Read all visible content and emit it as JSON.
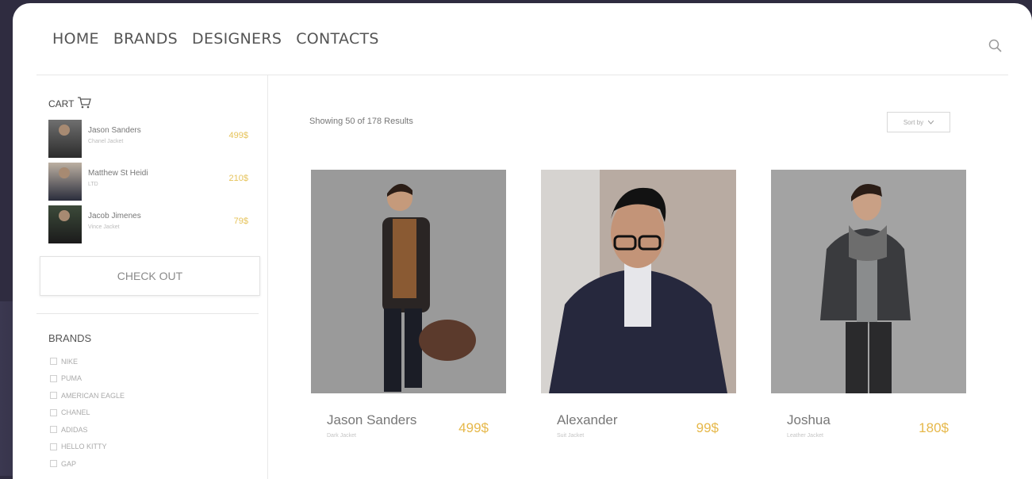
{
  "nav": {
    "items": [
      "HOME",
      "BRANDS",
      "DESIGNERS",
      "CONTACTS"
    ]
  },
  "sidebar": {
    "cart_title": "CART",
    "cart_items": [
      {
        "name": "Jason Sanders",
        "sub": "Chanel Jacket",
        "price": "499$"
      },
      {
        "name": "Matthew St Heidi",
        "sub": "LTD",
        "price": "210$"
      },
      {
        "name": "Jacob Jimenes",
        "sub": "Vince Jacket",
        "price": "79$"
      }
    ],
    "checkout_label": "CHECK OUT",
    "brands_title": "BRANDS",
    "brands": [
      "NIKE",
      "PUMA",
      "AMERICAN EAGLE",
      "CHANEL",
      "ADIDAS",
      "HELLO KITTY",
      "GAP"
    ]
  },
  "main": {
    "results_text": "Showing 50 of 178 Results",
    "sort_label": "Sort by",
    "products": [
      {
        "name": "Jason Sanders",
        "sub": "Dark Jacket",
        "price": "499$"
      },
      {
        "name": "Alexander",
        "sub": "Suit Jacket",
        "price": "99$"
      },
      {
        "name": "Joshua",
        "sub": "Leather Jacket",
        "price": "180$"
      }
    ]
  }
}
